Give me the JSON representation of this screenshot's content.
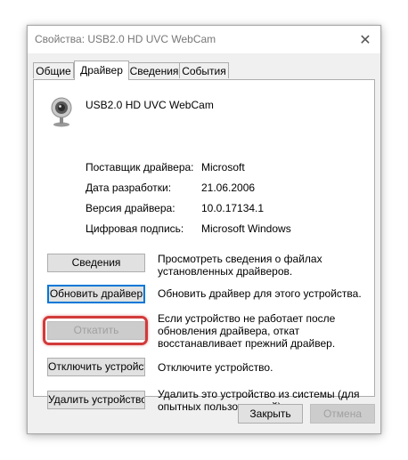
{
  "window": {
    "title": "Свойства: USB2.0 HD UVC WebCam",
    "close_glyph": "✕"
  },
  "tabs": [
    {
      "label": "Общие",
      "active": false
    },
    {
      "label": "Драйвер",
      "active": true
    },
    {
      "label": "Сведения",
      "active": false
    },
    {
      "label": "События",
      "active": false
    }
  ],
  "device": {
    "name": "USB2.0 HD UVC WebCam",
    "icon": "webcam-icon"
  },
  "properties": [
    {
      "label": "Поставщик драйвера:",
      "value": "Microsoft"
    },
    {
      "label": "Дата разработки:",
      "value": "21.06.2006"
    },
    {
      "label": "Версия драйвера:",
      "value": "10.0.17134.1"
    },
    {
      "label": "Цифровая подпись:",
      "value": "Microsoft Windows"
    }
  ],
  "actions": [
    {
      "button": "Сведения",
      "desc_lines": [
        "Просмотреть сведения о файлах",
        "установленных драйверов."
      ],
      "state": "normal"
    },
    {
      "button": "Обновить драйвер",
      "desc_lines": [
        "Обновить драйвер для этого устройства."
      ],
      "state": "primary"
    },
    {
      "button": "Откатить",
      "desc_lines": [
        "Если устройство не работает после",
        "обновления драйвера, откат",
        "восстанавливает прежний драйвер."
      ],
      "state": "disabled",
      "highlighted": true
    },
    {
      "button": "Отключить устройство",
      "desc_lines": [
        "Отключите устройство."
      ],
      "state": "normal"
    },
    {
      "button": "Удалить устройство",
      "desc_lines": [
        "Удалить это устройство из системы (для",
        "опытных пользователей)."
      ],
      "state": "normal"
    }
  ],
  "footer": {
    "ok_label": "Закрыть",
    "cancel_label": "Отмена"
  },
  "colors": {
    "highlight": "#d23a3a",
    "primary_border": "#0078d7"
  }
}
